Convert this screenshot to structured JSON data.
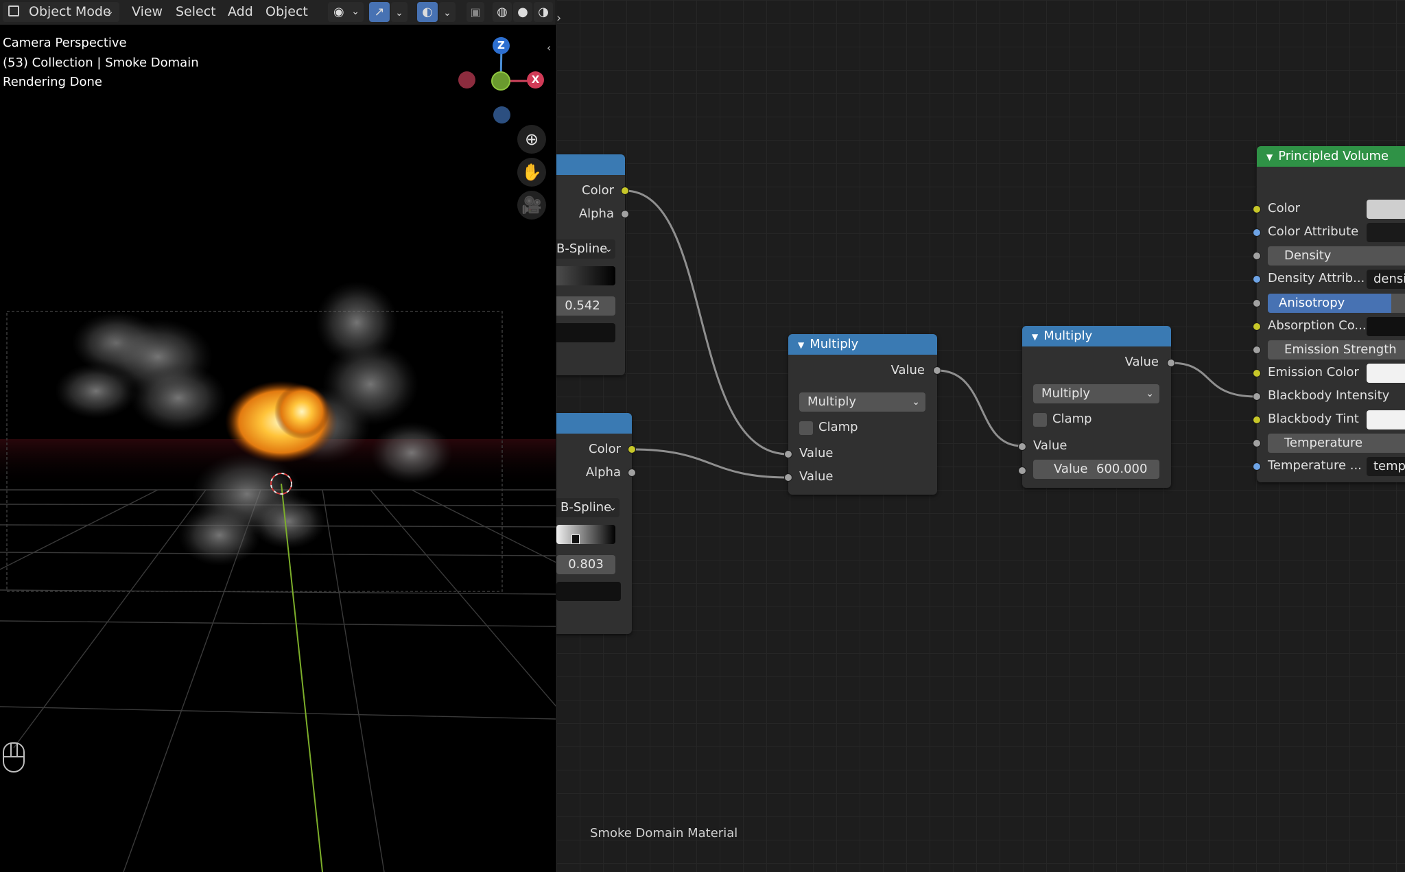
{
  "viewport": {
    "header": {
      "mode_label": "Object Mode",
      "menus": [
        "View",
        "Select",
        "Add",
        "Object"
      ]
    },
    "overlay": {
      "line1": "Camera Perspective",
      "line2": "(53) Collection | Smoke Domain",
      "line3": "Rendering Done"
    },
    "gizmo": {
      "z": "Z",
      "x": "X"
    }
  },
  "node_editor": {
    "material_label": "Smoke Domain Material",
    "ramp1": {
      "out_color": "Color",
      "out_alpha": "Alpha",
      "interp": "B-Spline",
      "pos": "0.542"
    },
    "ramp2": {
      "out_color": "Color",
      "out_alpha": "Alpha",
      "interp": "B-Spline",
      "pos": "0.803"
    },
    "multiply1": {
      "title": "Multiply",
      "out": "Value",
      "op": "Multiply",
      "clamp": "Clamp",
      "in1": "Value",
      "in2": "Value"
    },
    "multiply2": {
      "title": "Multiply",
      "out": "Value",
      "op": "Multiply",
      "clamp": "Clamp",
      "in1": "Value",
      "in2_label": "Value",
      "in2_value": "600.000"
    },
    "principled": {
      "title": "Principled Volume",
      "rows": [
        "Color",
        "Color Attribute",
        "Density",
        "Density Attrib...",
        "Anisotropy",
        "Absorption Co...",
        "Emission Strength",
        "Emission Color",
        "Blackbody Intensity",
        "Blackbody Tint",
        "Temperature",
        "Temperature ..."
      ],
      "density_attr_value": "densi",
      "temp_attr_value": "temp"
    }
  },
  "colors": {
    "accent": "#4772b3",
    "node_header_blue": "#3a7ab3",
    "node_header_green": "#2f9246",
    "socket_yellow": "#c7c729",
    "socket_grey": "#a1a1a1",
    "socket_blue": "#6ea4e6"
  }
}
